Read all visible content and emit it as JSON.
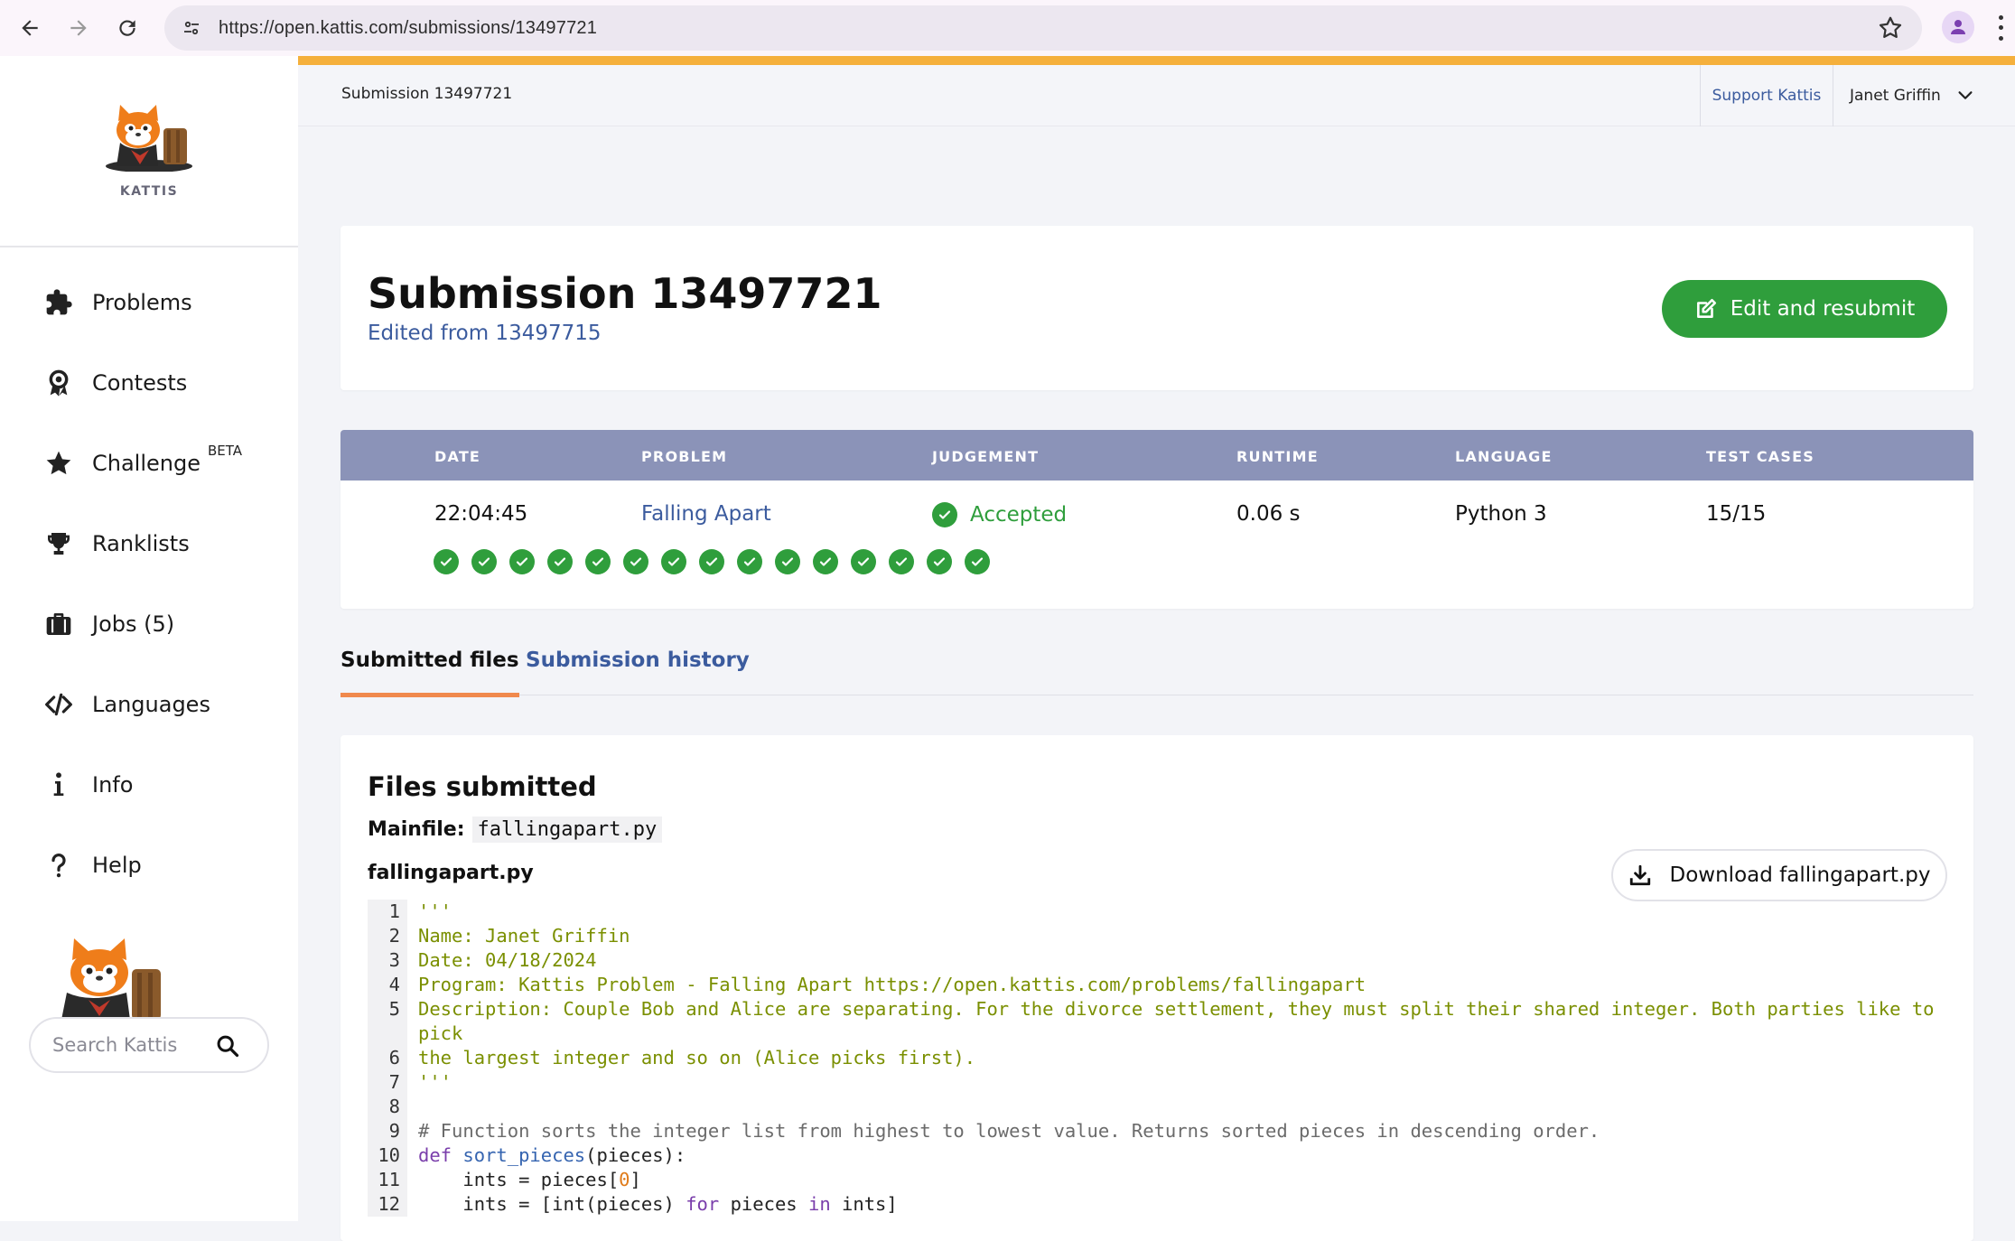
{
  "browser": {
    "url": "https://open.kattis.com/submissions/13497721"
  },
  "sidebar": {
    "logo_text": "KATTIS",
    "items": [
      {
        "label": "Problems",
        "icon": "puzzle-icon"
      },
      {
        "label": "Contests",
        "icon": "award-icon"
      },
      {
        "label": "Challenge",
        "icon": "star-icon",
        "badge": "BETA"
      },
      {
        "label": "Ranklists",
        "icon": "trophy-icon"
      },
      {
        "label": "Jobs (5)",
        "icon": "briefcase-icon"
      },
      {
        "label": "Languages",
        "icon": "code-icon"
      },
      {
        "label": "Info",
        "icon": "info-icon"
      },
      {
        "label": "Help",
        "icon": "help-icon"
      }
    ],
    "search_placeholder": "Search Kattis"
  },
  "header": {
    "breadcrumb": "Submission 13497721",
    "support_label": "Support Kattis",
    "user_name": "Janet Griffin"
  },
  "submission": {
    "title": "Submission 13497721",
    "edited_from": "Edited from 13497715",
    "resubmit_label": "Edit and resubmit"
  },
  "table": {
    "headers": [
      "DATE",
      "PROBLEM",
      "JUDGEMENT",
      "RUNTIME",
      "LANGUAGE",
      "TEST CASES"
    ],
    "row": {
      "date": "22:04:45",
      "problem": "Falling Apart",
      "judgement": "Accepted",
      "runtime": "0.06 s",
      "language": "Python 3",
      "test_cases": "15/15"
    },
    "test_case_results": [
      "pass",
      "pass",
      "pass",
      "pass",
      "pass",
      "pass",
      "pass",
      "pass",
      "pass",
      "pass",
      "pass",
      "pass",
      "pass",
      "pass",
      "pass"
    ],
    "accent_color": "#2f9e3c"
  },
  "tabs": [
    {
      "label": "Submitted files",
      "active": true
    },
    {
      "label": "Submission history",
      "active": false
    }
  ],
  "files": {
    "title": "Files submitted",
    "mainfile_label": "Mainfile:",
    "mainfile_name": "fallingapart.py",
    "filename": "fallingapart.py",
    "download_label": "Download fallingapart.py",
    "code_lines": [
      {
        "n": "1",
        "text": "'''",
        "kind": "str"
      },
      {
        "n": "2",
        "text": "Name: Janet Griffin",
        "kind": "str"
      },
      {
        "n": "3",
        "text": "Date: 04/18/2024",
        "kind": "str"
      },
      {
        "n": "4",
        "text": "Program: Kattis Problem - Falling Apart https://open.kattis.com/problems/fallingapart",
        "kind": "str"
      },
      {
        "n": "5",
        "text": "Description: Couple Bob and Alice are separating. For the divorce settlement, they must split their shared integer. Both parties like to",
        "kind": "str"
      },
      {
        "n": "",
        "text": "pick",
        "kind": "str"
      },
      {
        "n": "6",
        "text": "the largest integer and so on (Alice picks first).",
        "kind": "str"
      },
      {
        "n": "7",
        "text": "'''",
        "kind": "str"
      },
      {
        "n": "8",
        "text": "",
        "kind": "plain"
      },
      {
        "n": "9",
        "text": "# Function sorts the integer list from highest to lowest value. Returns sorted pieces in descending order.",
        "kind": "cmt"
      },
      {
        "n": "10",
        "kind": "def",
        "kw": "def",
        "fn": "sort_pieces",
        "rest": "(pieces):"
      },
      {
        "n": "11",
        "kind": "assign_index",
        "pre": "    ints = pieces[",
        "num": "0",
        "post": "]"
      },
      {
        "n": "12",
        "kind": "listcomp",
        "pre": "    ints = [int(pieces) ",
        "kw1": "for",
        "mid": " pieces ",
        "kw2": "in",
        "post": " ints]"
      }
    ]
  }
}
